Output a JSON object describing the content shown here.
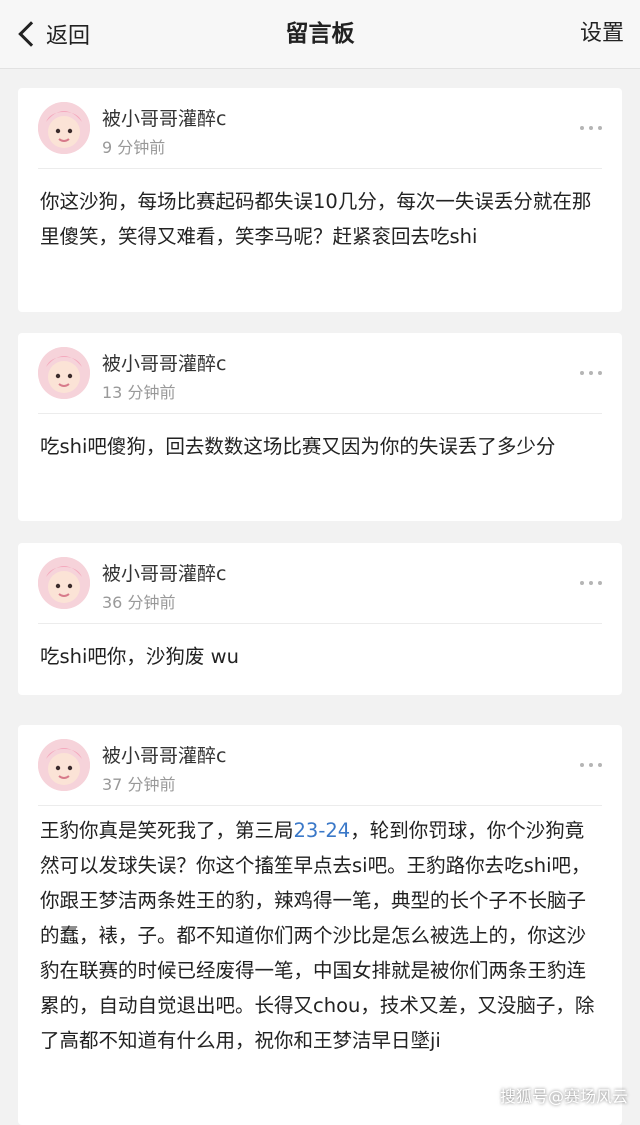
{
  "nav": {
    "back_label": "返回",
    "title": "留言板",
    "settings_label": "设置"
  },
  "posts": [
    {
      "username": "被小哥哥灌醉c",
      "time": "9 分钟前",
      "content": "你这沙狗，每场比赛起码都失误10几分，每次一失误丢分就在那里傻笑，笑得又难看，笑李马呢？赶紧衮回去吃shi"
    },
    {
      "username": "被小哥哥灌醉c",
      "time": "13 分钟前",
      "content": "吃shi吧傻狗，回去数数这场比赛又因为你的失误丢了多少分"
    },
    {
      "username": "被小哥哥灌醉c",
      "time": "36 分钟前",
      "content": "吃shi吧你，沙狗废 wu"
    },
    {
      "username": "被小哥哥灌醉c",
      "time": "37 分钟前",
      "content_before": "王豹你真是笑死我了，第三局",
      "content_score": "23-24",
      "content_after": "，轮到你罚球，你个沙狗竟然可以发球失误？你这个搐笙早点去si吧。王豹路你去吃shi吧，你跟王梦洁两条姓王的豹，辣鸡得一笔，典型的长个子不长脑子的蠢，裱，子。都不知道你们两个沙比是怎么被选上的，你这沙豹在联赛的时候已经废得一笔，中国女排就是被你们两条王豹连累的，自动自觉退出吧。长得又chou，技术又差，又没脑子，除了高都不知道有什么用，祝你和王梦洁早日墜ji"
    }
  ],
  "watermark": "搜狐号@赛场风云",
  "colors": {
    "link": "#3a78c8",
    "background": "#f2f2f2"
  }
}
